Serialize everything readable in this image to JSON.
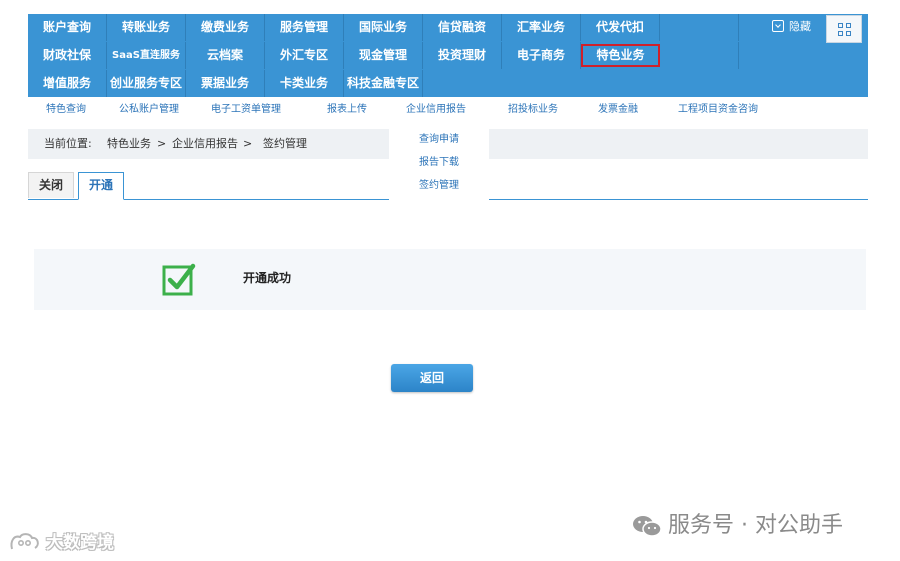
{
  "nav": {
    "row1": [
      "账户查询",
      "转账业务",
      "缴费业务",
      "服务管理",
      "国际业务",
      "信贷融资",
      "汇率业务",
      "代发代扣"
    ],
    "row2": [
      "财政社保",
      "SaaS直连服务",
      "云档案",
      "外汇专区",
      "现金管理",
      "投资理财",
      "电子商务",
      "特色业务"
    ],
    "row3": [
      "增值服务",
      "创业服务专区",
      "票据业务",
      "卡类业务",
      "科技金融专区"
    ],
    "hide_label": "隐藏",
    "active_item": "特色业务",
    "active_color": "#d0202a",
    "bar_color": "#3a94d4"
  },
  "subnav": {
    "items": [
      "特色查询",
      "公私账户管理",
      "电子工资单管理",
      "报表上传",
      "企业信用报告",
      "招投标业务",
      "发票金融",
      "工程项目资金咨询"
    ]
  },
  "dropdown": {
    "items": [
      "查询申请",
      "报告下载",
      "签约管理"
    ]
  },
  "breadcrumb": {
    "prefix": "当前位置:",
    "level1": "特色业务",
    "sep1": ">",
    "level2": "企业信用报告",
    "sep2": ">",
    "level3": "签约管理"
  },
  "tabs": {
    "close_label": "关闭",
    "open_label": "开通"
  },
  "result": {
    "message": "开通成功",
    "icon": "checkbox-checked-icon",
    "icon_color": "#3cb04a"
  },
  "back_button": {
    "label": "返回"
  },
  "watermarks": {
    "right_text": "服务号 · 对公助手",
    "left_text": "大数跨境"
  }
}
